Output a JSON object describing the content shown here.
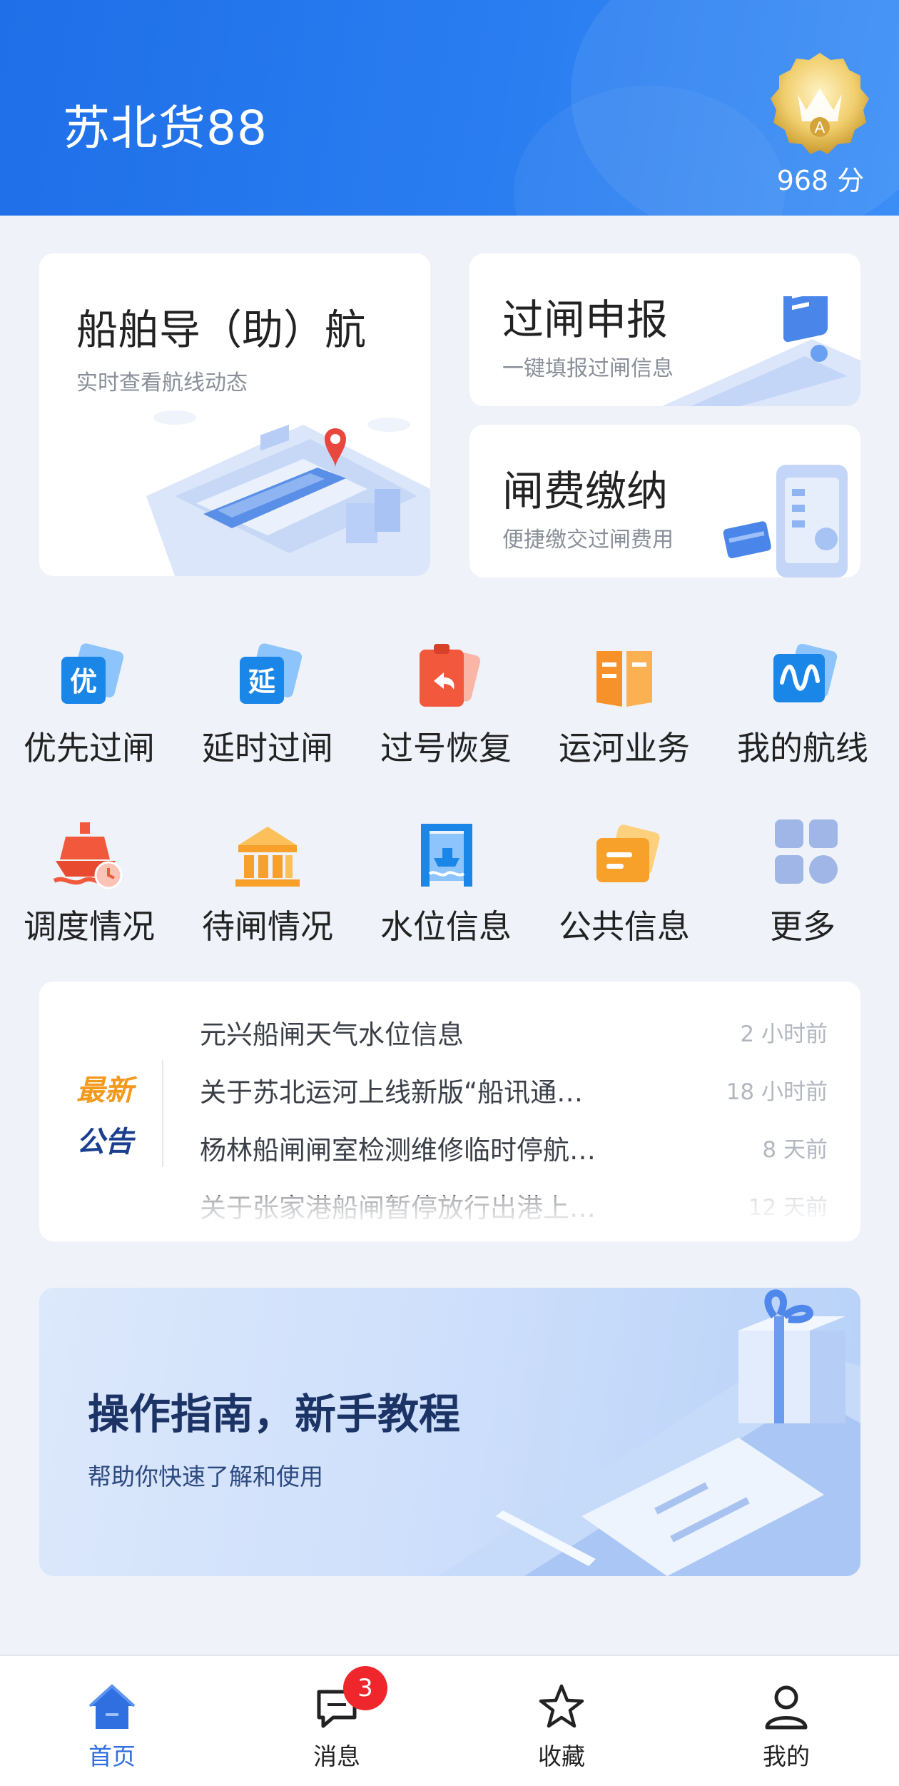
{
  "header": {
    "title": "苏北货88",
    "badge_letter": "A",
    "score": "968 分"
  },
  "cards": {
    "navigation": {
      "title": "船舶导（助）航",
      "subtitle": "实时查看航线动态"
    },
    "declare": {
      "title": "过闸申报",
      "subtitle": "一键填报过闸信息"
    },
    "fee": {
      "title": "闸费缴纳",
      "subtitle": "便捷缴交过闸费用"
    }
  },
  "grid": {
    "row1": [
      {
        "label": "优先过闸",
        "icon": "priority-icon",
        "glyph": "优",
        "color": "#1a86e8"
      },
      {
        "label": "延时过闸",
        "icon": "delay-icon",
        "glyph": "延",
        "color": "#1a86e8"
      },
      {
        "label": "过号恢复",
        "icon": "restore-icon",
        "glyph": "↶",
        "color": "#f2593c"
      },
      {
        "label": "运河业务",
        "icon": "canal-business-icon",
        "glyph": "",
        "color": "#f7922a"
      },
      {
        "label": "我的航线",
        "icon": "my-route-icon",
        "glyph": "∿",
        "color": "#1a86e8"
      }
    ],
    "row2": [
      {
        "label": "调度情况",
        "icon": "dispatch-icon",
        "glyph": "",
        "color": "#f2593c"
      },
      {
        "label": "待闸情况",
        "icon": "waiting-lock-icon",
        "glyph": "",
        "color": "#f7a02a"
      },
      {
        "label": "水位信息",
        "icon": "water-level-icon",
        "glyph": "",
        "color": "#1a86e8"
      },
      {
        "label": "公共信息",
        "icon": "public-info-icon",
        "glyph": "",
        "color": "#f7a02a"
      },
      {
        "label": "更多",
        "icon": "more-grid-icon",
        "glyph": "",
        "color": "#9fb6e6"
      }
    ]
  },
  "notice": {
    "logo_line1": "最新",
    "logo_line2": "公告",
    "items": [
      {
        "title": "元兴船闸天气水位信息",
        "time": "2 小时前"
      },
      {
        "title": "关于苏北运河上线新版“船讯通…",
        "time": "18 小时前"
      },
      {
        "title": "杨林船闸闸室检测维修临时停航…",
        "time": "8 天前"
      },
      {
        "title": "关于张家港船闸暂停放行出港上…",
        "time": "12 天前"
      }
    ]
  },
  "guide": {
    "title": "操作指南，新手教程",
    "subtitle": "帮助你快速了解和使用"
  },
  "tabbar": {
    "home": "首页",
    "messages": "消息",
    "messages_badge": "3",
    "favorites": "收藏",
    "mine": "我的"
  },
  "colors": {
    "header_blue": "#2a7df0",
    "active_tab": "#2f6fe0",
    "badge_red": "#f0262d",
    "notice_orange": "#f39a1e",
    "notice_navy": "#1a3f8f"
  }
}
